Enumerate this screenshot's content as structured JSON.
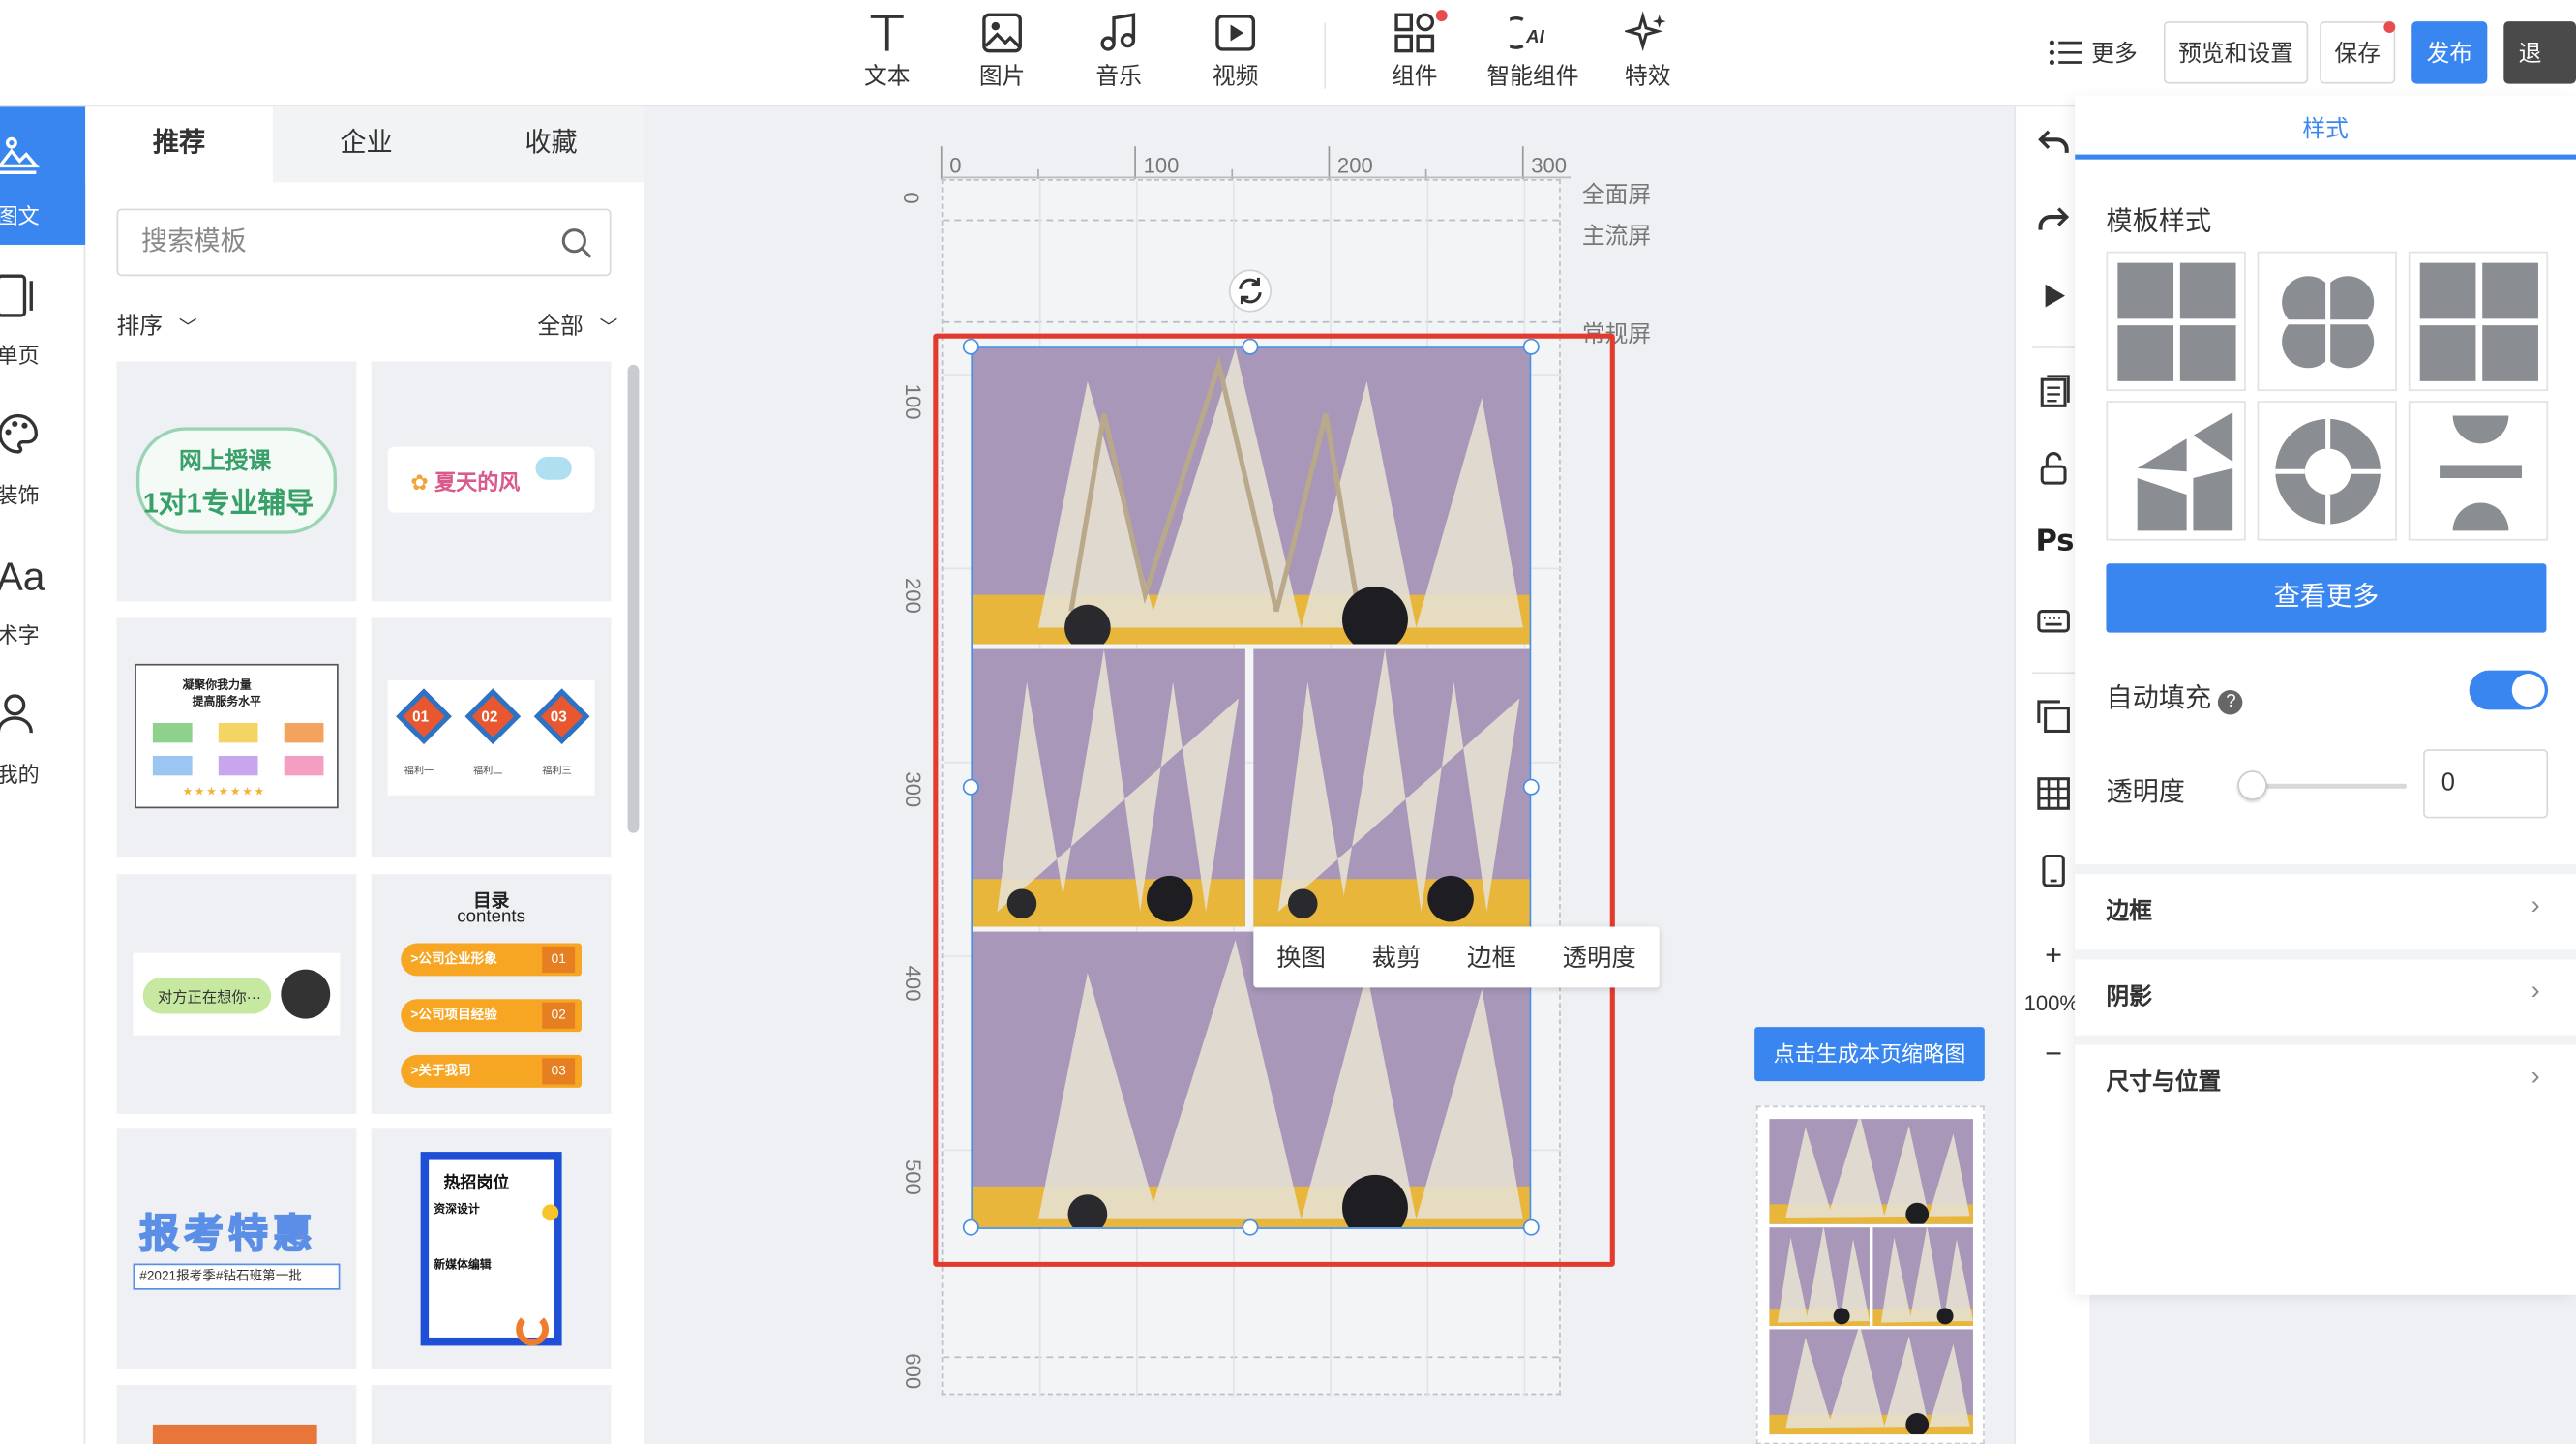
{
  "toolbar": {
    "tools": [
      {
        "label": "文本",
        "icon": "text-icon"
      },
      {
        "label": "图片",
        "icon": "image-icon"
      },
      {
        "label": "音乐",
        "icon": "music-icon"
      },
      {
        "label": "视频",
        "icon": "video-icon"
      },
      {
        "label": "组件",
        "icon": "components-icon"
      },
      {
        "label": "智能组件",
        "icon": "ai-component-icon"
      },
      {
        "label": "特效",
        "icon": "effects-icon"
      }
    ],
    "more_label": "更多",
    "preview_label": "预览和设置",
    "save_label": "保存",
    "publish_label": "发布",
    "exit_label": "退出"
  },
  "rail": {
    "items": [
      {
        "label": "图文",
        "icon": "image-text-icon",
        "active": true
      },
      {
        "label": "单页",
        "icon": "single-page-icon"
      },
      {
        "label": "装饰",
        "icon": "palette-icon"
      },
      {
        "label": "术字",
        "icon": "art-text-icon",
        "glyph": "Aa"
      },
      {
        "label": "我的",
        "icon": "user-icon"
      }
    ]
  },
  "templates": {
    "tabs": [
      "推荐",
      "企业",
      "收藏"
    ],
    "search_placeholder": "搜索模板",
    "sort_label": "排序",
    "filter_label": "全部",
    "cards": [
      {
        "text": "网上授课",
        "sub": "1对1专业辅导"
      },
      {
        "text": "夏天的风"
      },
      {
        "text": "凝聚你我力量",
        "sub": "提高服务水平"
      },
      {
        "badges": [
          "01",
          "02",
          "03"
        ],
        "captions": [
          "福利一",
          "福利二",
          "福利三"
        ]
      },
      {
        "text": "对方正在想你···"
      },
      {
        "text": "目录",
        "sub": "contents",
        "items": [
          ">公司企业形象",
          ">公司项目经验",
          ">关于我司"
        ],
        "nums": [
          "01",
          "02",
          "03"
        ]
      },
      {
        "text": "报考特惠",
        "sub": "#2021报考季#钻石班第一批"
      },
      {
        "text": "热招岗位",
        "sub1": "资深设计",
        "sub2": "新媒体编辑"
      }
    ]
  },
  "canvas": {
    "ruler_h": [
      "0",
      "100",
      "200",
      "300"
    ],
    "ruler_v": [
      "0",
      "100",
      "200",
      "300",
      "400",
      "500",
      "600"
    ],
    "screens": [
      "全面屏",
      "主流屏",
      "常规屏"
    ],
    "context_menu": [
      "换图",
      "裁剪",
      "边框",
      "透明度"
    ],
    "thumbnail_button": "点击生成本页缩略图"
  },
  "right_tools": {
    "zoom": "100%",
    "plus": "+",
    "minus": "−",
    "ps_label": "Ps"
  },
  "props": {
    "tab": "样式",
    "section_title": "模板样式",
    "view_more": "查看更多",
    "auto_fill_label": "自动填充",
    "auto_fill": true,
    "opacity_label": "透明度",
    "opacity_value": "0",
    "accordions": [
      "边框",
      "阴影",
      "尺寸与位置"
    ]
  },
  "colors": {
    "accent": "#3a86f0",
    "highlight_box": "#e23b2e",
    "notification_dot": "#e84c4c"
  }
}
